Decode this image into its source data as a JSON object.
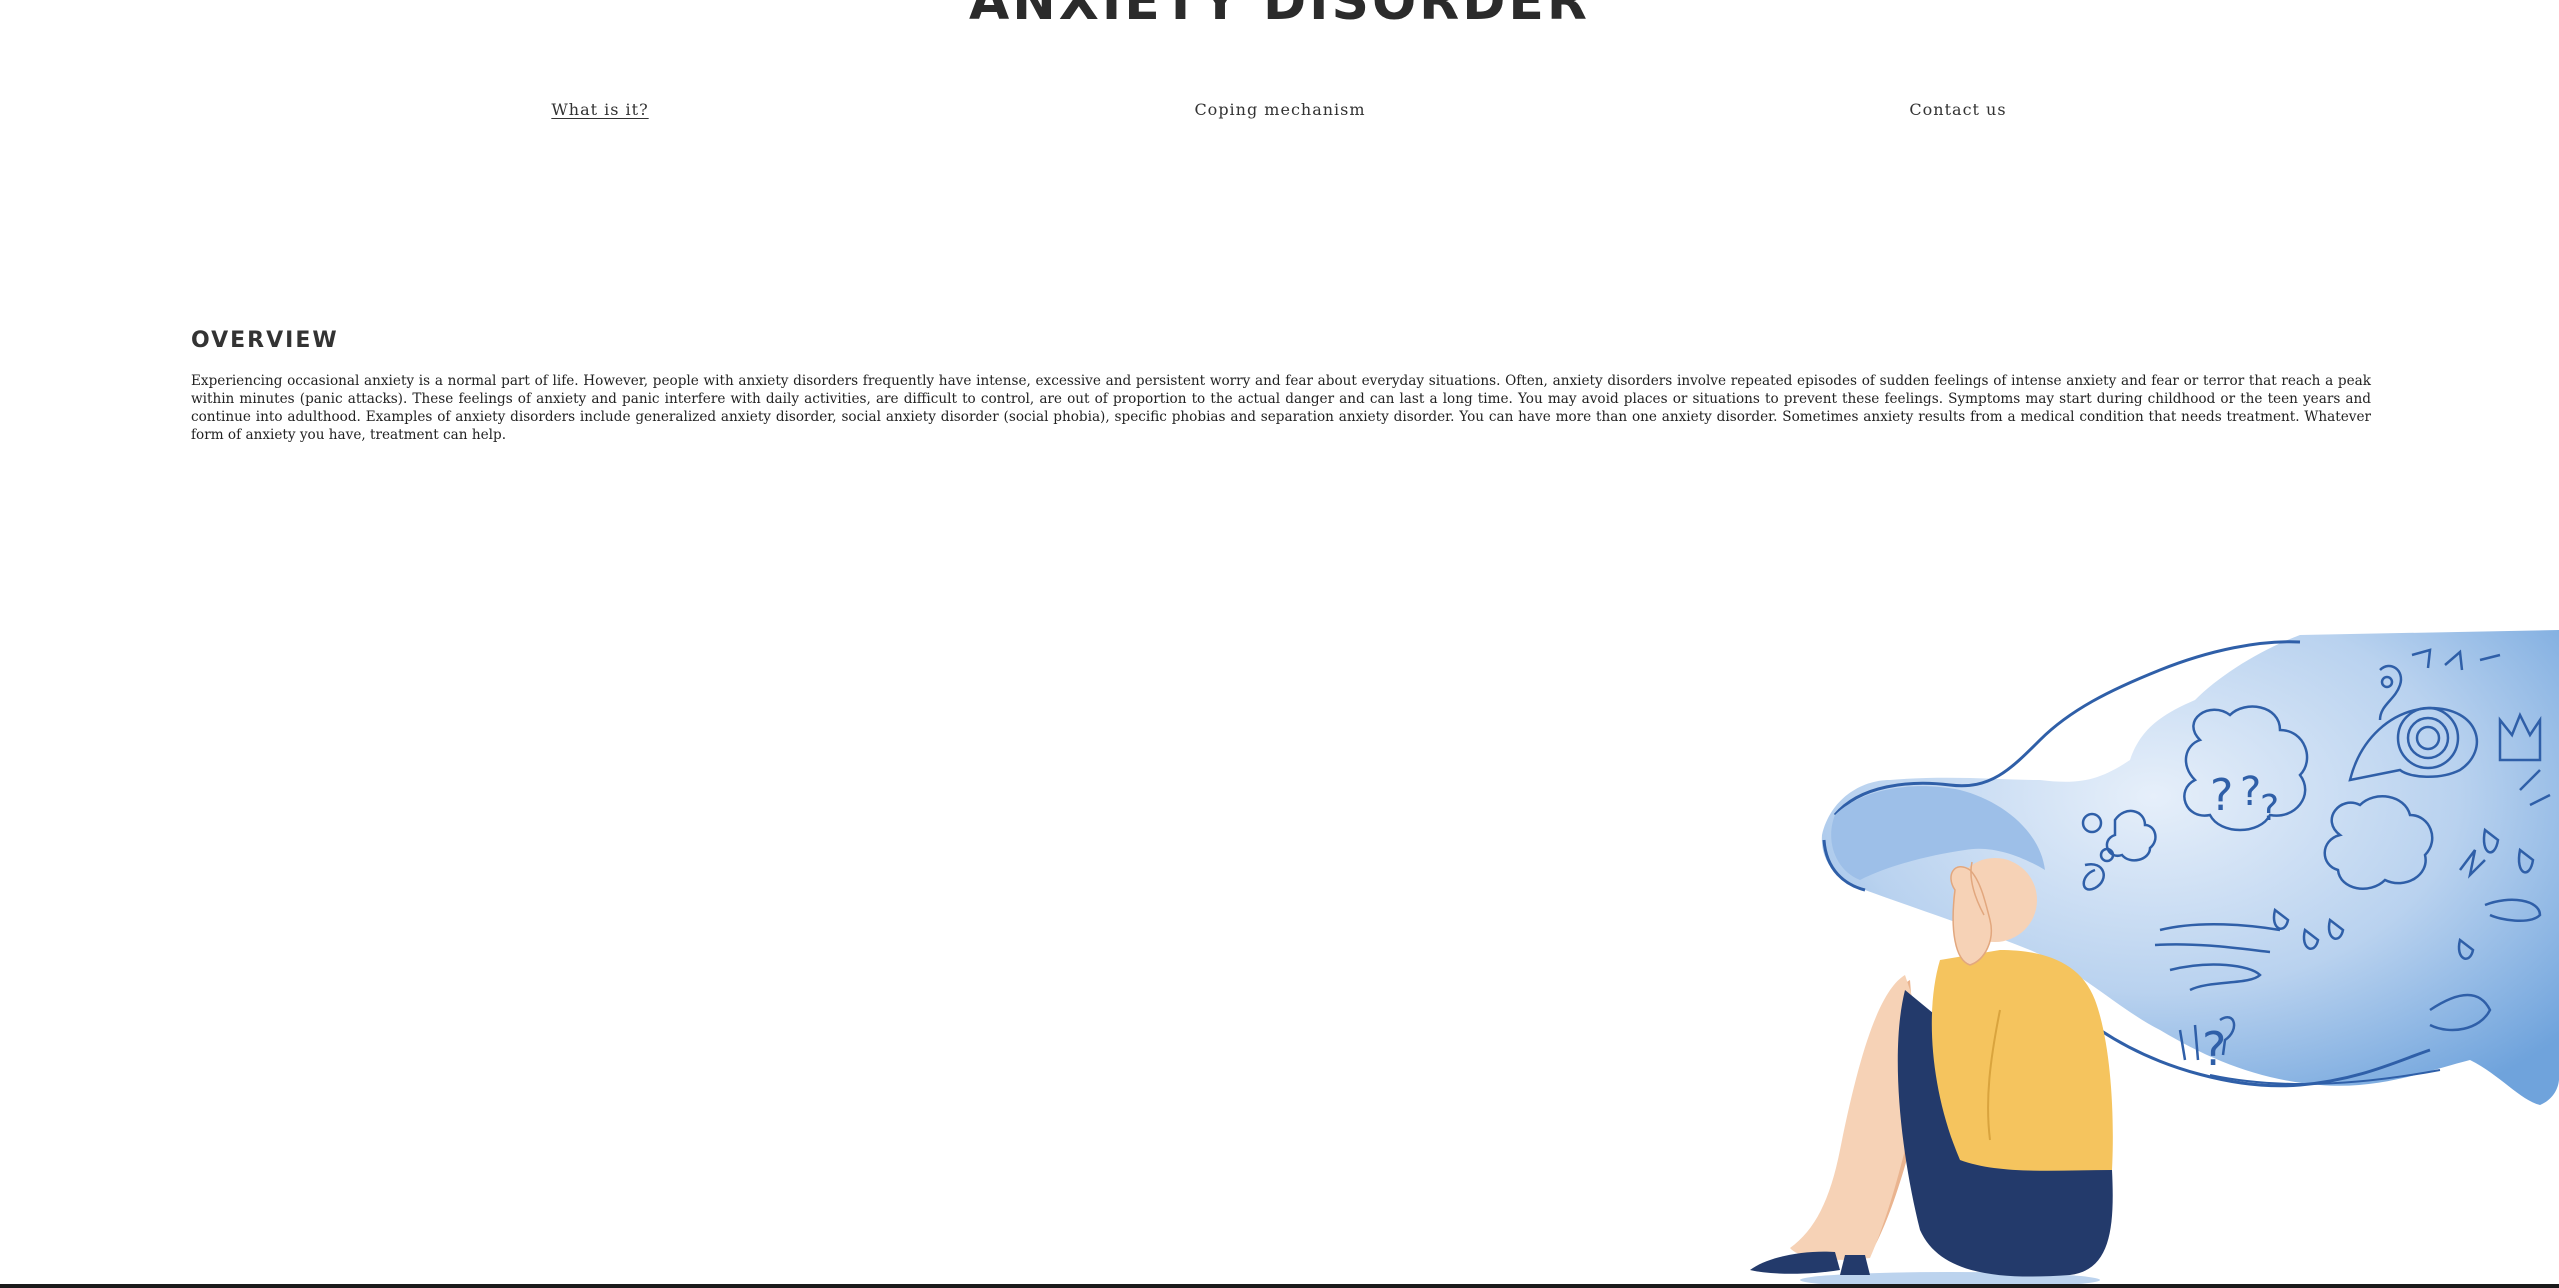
{
  "header": {
    "title": "ANXIETY DISORDER"
  },
  "nav": {
    "items": [
      {
        "label": "What is it?",
        "active": true
      },
      {
        "label": "Coping mechanism",
        "active": false
      },
      {
        "label": "Contact us",
        "active": false
      }
    ]
  },
  "overview": {
    "heading": "OVERVIEW",
    "body": "Experiencing occasional anxiety is a normal part of life. However, people with anxiety disorders frequently have intense, excessive and persistent worry and fear about everyday situations. Often, anxiety disorders involve repeated episodes of sudden feelings of intense anxiety and fear or terror that reach a peak within minutes (panic attacks). These feelings of anxiety and panic interfere with daily activities, are difficult to control, are out of proportion to the actual danger and can last a long time. You may avoid places or situations to prevent these feelings. Symptoms may start during childhood or the teen years and continue into adulthood. Examples of anxiety disorders include generalized anxiety disorder, social anxiety disorder (social phobia), specific phobias and separation anxiety disorder. You can have more than one anxiety disorder. Sometimes anxiety results from a medical condition that needs treatment. Whatever form of anxiety you have, treatment can help."
  },
  "illustration": {
    "icon": "anxious-person-illustration",
    "colors": {
      "hair_light": "#cfe0f5",
      "hair_dark": "#6fa3dc",
      "line": "#2f5fa8",
      "shirt": "#f5c45e",
      "skirt": "#233a6b",
      "skin": "#f6d2b6",
      "skin_shadow": "#eab48f"
    }
  }
}
